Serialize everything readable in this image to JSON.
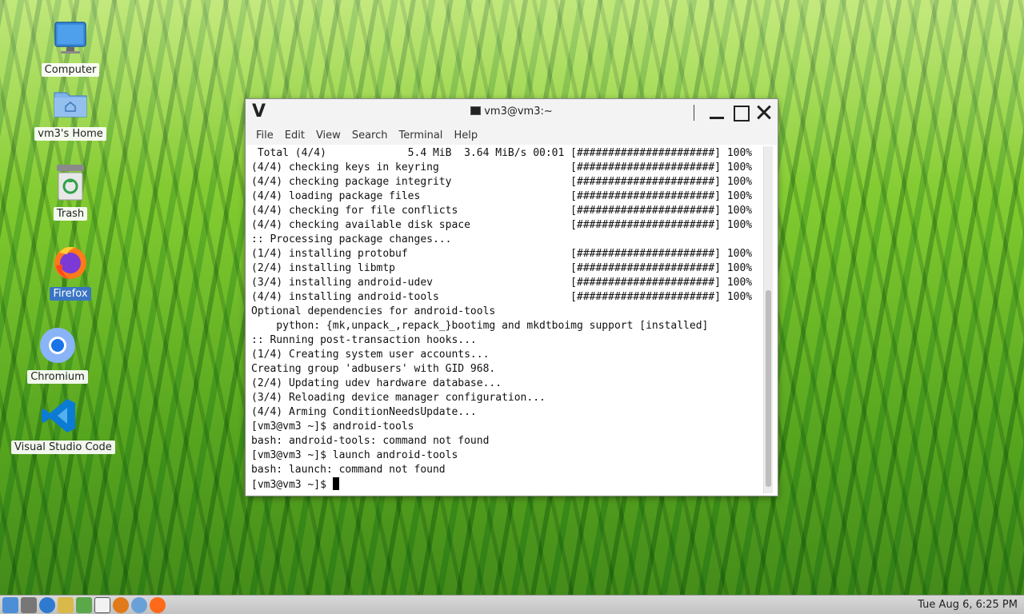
{
  "desktop": {
    "icons": [
      {
        "label": "Computer"
      },
      {
        "label": "vm3's Home"
      },
      {
        "label": "Trash"
      },
      {
        "label": "Firefox"
      },
      {
        "label": "Chromium"
      },
      {
        "label": "Visual Studio Code"
      }
    ]
  },
  "window": {
    "title": "vm3@vm3:~",
    "logo": "V",
    "menu": [
      "File",
      "Edit",
      "View",
      "Search",
      "Terminal",
      "Help"
    ]
  },
  "terminal": {
    "lines": [
      " Total (4/4)             5.4 MiB  3.64 MiB/s 00:01 [######################] 100%",
      "(4/4) checking keys in keyring                     [######################] 100%",
      "(4/4) checking package integrity                   [######################] 100%",
      "(4/4) loading package files                        [######################] 100%",
      "(4/4) checking for file conflicts                  [######################] 100%",
      "(4/4) checking available disk space                [######################] 100%",
      ":: Processing package changes...",
      "(1/4) installing protobuf                          [######################] 100%",
      "(2/4) installing libmtp                            [######################] 100%",
      "(3/4) installing android-udev                      [######################] 100%",
      "(4/4) installing android-tools                     [######################] 100%",
      "Optional dependencies for android-tools",
      "    python: {mk,unpack_,repack_}bootimg and mkdtboimg support [installed]",
      ":: Running post-transaction hooks...",
      "(1/4) Creating system user accounts...",
      "Creating group 'adbusers' with GID 968.",
      "(2/4) Updating udev hardware database...",
      "(3/4) Reloading device manager configuration...",
      "(4/4) Arming ConditionNeedsUpdate...",
      "[vm3@vm3 ~]$ android-tools",
      "bash: android-tools: command not found",
      "[vm3@vm3 ~]$ launch android-tools",
      "bash: launch: command not found"
    ],
    "prompt": "[vm3@vm3 ~]$ "
  },
  "taskbar": {
    "clock": "Tue Aug  6, 6:25 PM"
  },
  "colors": {
    "taskbar_bg": "#c8c8c8",
    "selected_label": "#3a75c4"
  }
}
